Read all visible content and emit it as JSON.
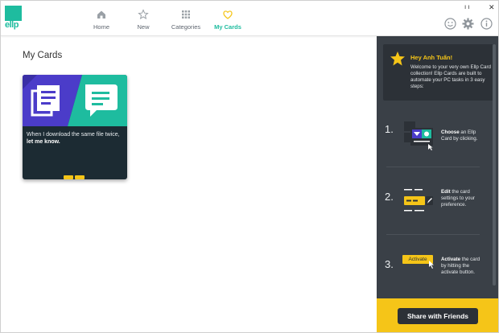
{
  "app": {
    "logo_text": "ellp"
  },
  "nav": {
    "home": "Home",
    "new": "New",
    "categories": "Categories",
    "my_cards": "My Cards"
  },
  "main": {
    "title": "My Cards",
    "card": {
      "text_prefix": "When I download the same file twice, ",
      "text_bold": "let me know."
    }
  },
  "panel": {
    "greeting_title": "Hey Anh Tuấn!",
    "greeting_body": "Welcome to your very own Ellp Card collection! Ellp Cards are built to automate your PC tasks in 3 easy steps:",
    "steps": [
      {
        "num": "1.",
        "bold": "Choose",
        "rest": " an Ellp Card by clicking."
      },
      {
        "num": "2.",
        "bold": "Edit",
        "rest": " the card settings to your preference."
      },
      {
        "num": "3.",
        "bold": "Activate",
        "rest": " the card by hitting the activate button.",
        "button_label": "Activate"
      }
    ],
    "share_label": "Share with Friends"
  },
  "window_controls": {
    "minimize": "ı ı",
    "close": "✕"
  },
  "colors": {
    "accent": "#1ebc9f",
    "yellow": "#f5c518",
    "panel": "#3a4047",
    "card_dark": "#1c2b33",
    "purple": "#4b3cc9"
  }
}
